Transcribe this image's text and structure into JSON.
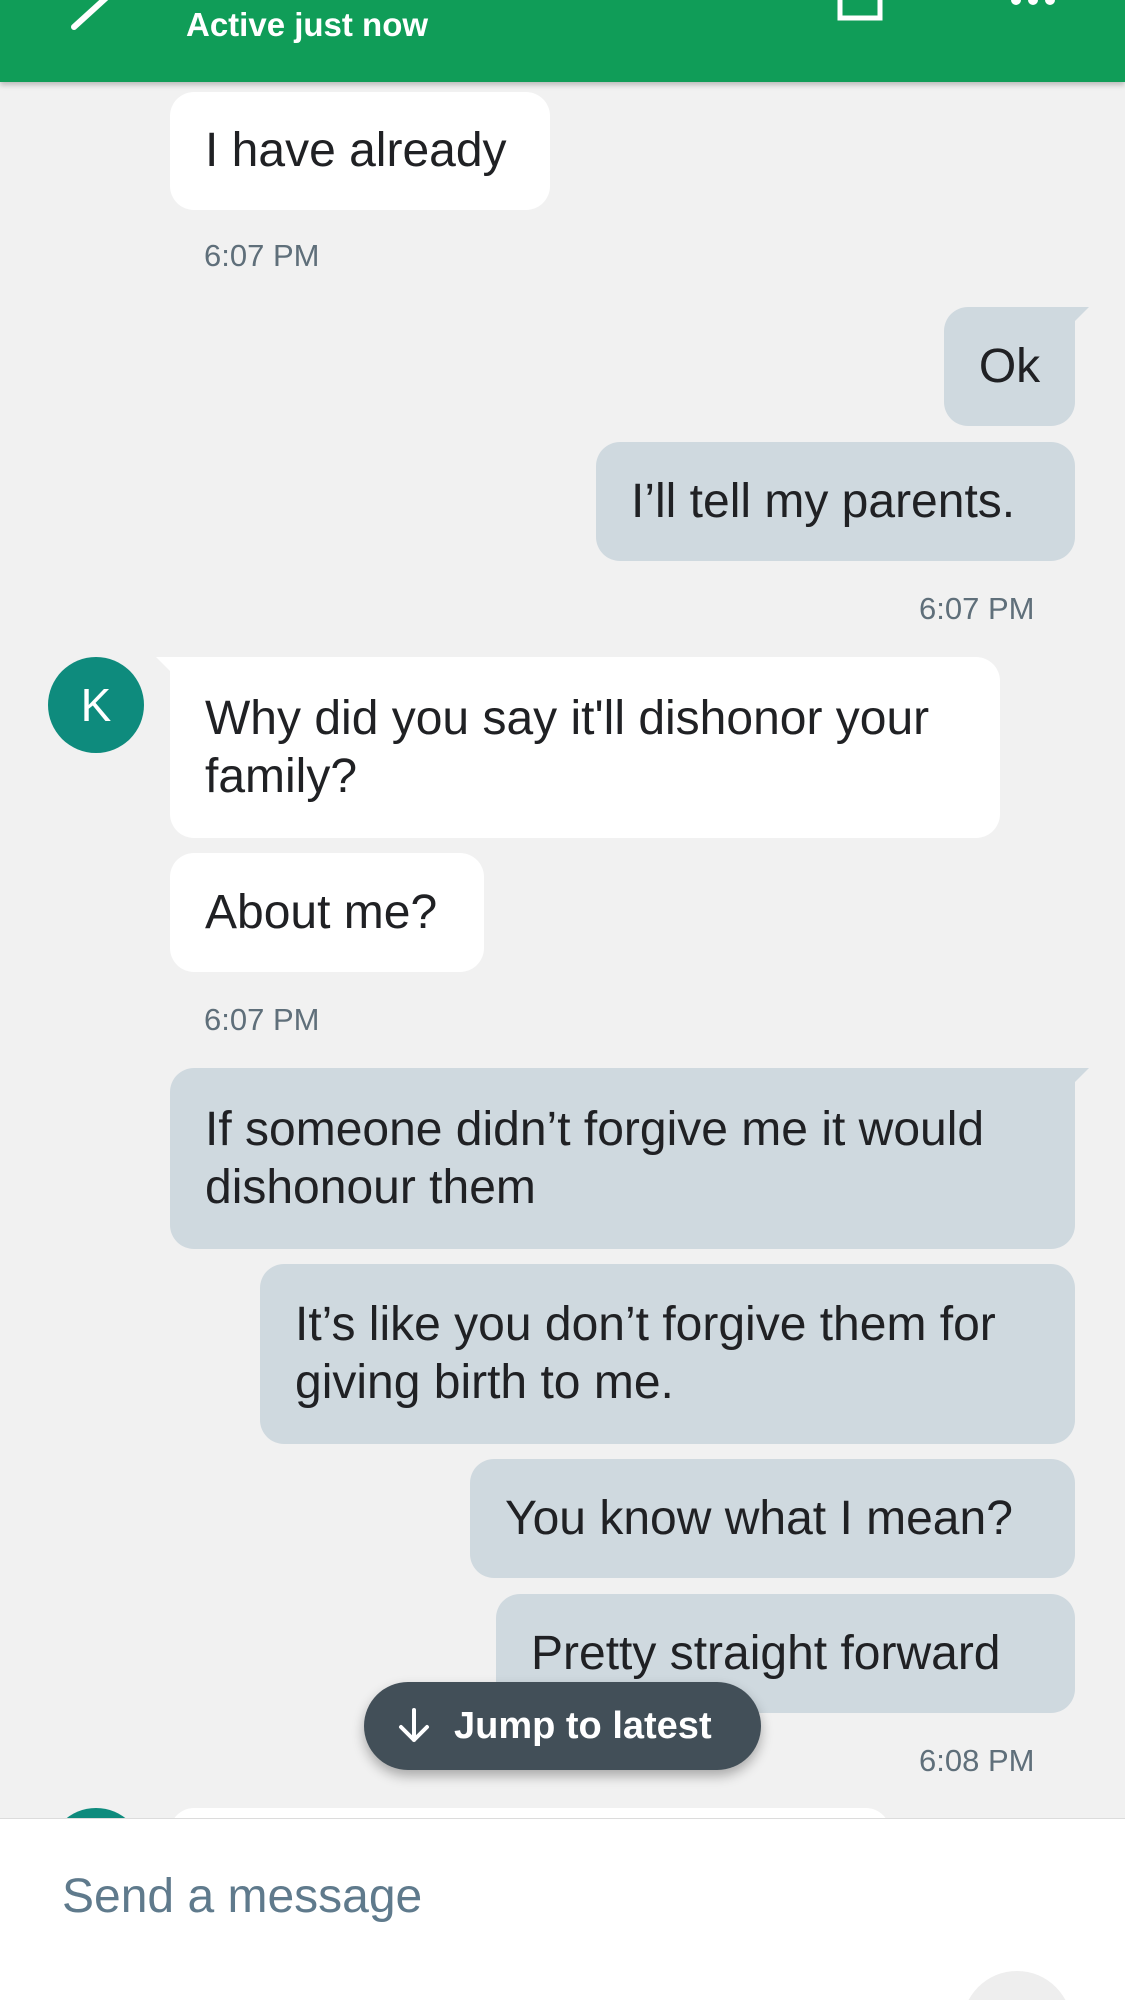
{
  "header": {
    "status": "Active just now",
    "icons": {
      "back": "arrow-back-icon",
      "video": "video-call-icon",
      "more": "more-vert-icon"
    },
    "color": "#109d58"
  },
  "messages": [
    {
      "side": "in",
      "text": "I have already"
    },
    {
      "side": "time",
      "text": "6:07 PM"
    },
    {
      "side": "out",
      "text": "Ok"
    },
    {
      "side": "out",
      "text": "I’ll tell my parents."
    },
    {
      "side": "time",
      "text": "6:07 PM"
    },
    {
      "side": "in",
      "avatar": "K",
      "text": "Why did you say it'll dishonor your family?"
    },
    {
      "side": "in",
      "text": "About me?"
    },
    {
      "side": "time",
      "text": "6:07 PM"
    },
    {
      "side": "out",
      "text": "If someone didn’t forgive me it would dishonour them"
    },
    {
      "side": "out",
      "text": "It’s like you don’t forgive them for giving birth to me."
    },
    {
      "side": "out",
      "text": "You know what I mean?"
    },
    {
      "side": "out",
      "text": "Pretty straight forward"
    },
    {
      "side": "time",
      "text": "6:08 PM"
    }
  ],
  "jump": {
    "label": "Jump to latest",
    "icon": "arrow-down-icon"
  },
  "composer": {
    "placeholder": "Send a message",
    "send_icon": "send-icon"
  }
}
